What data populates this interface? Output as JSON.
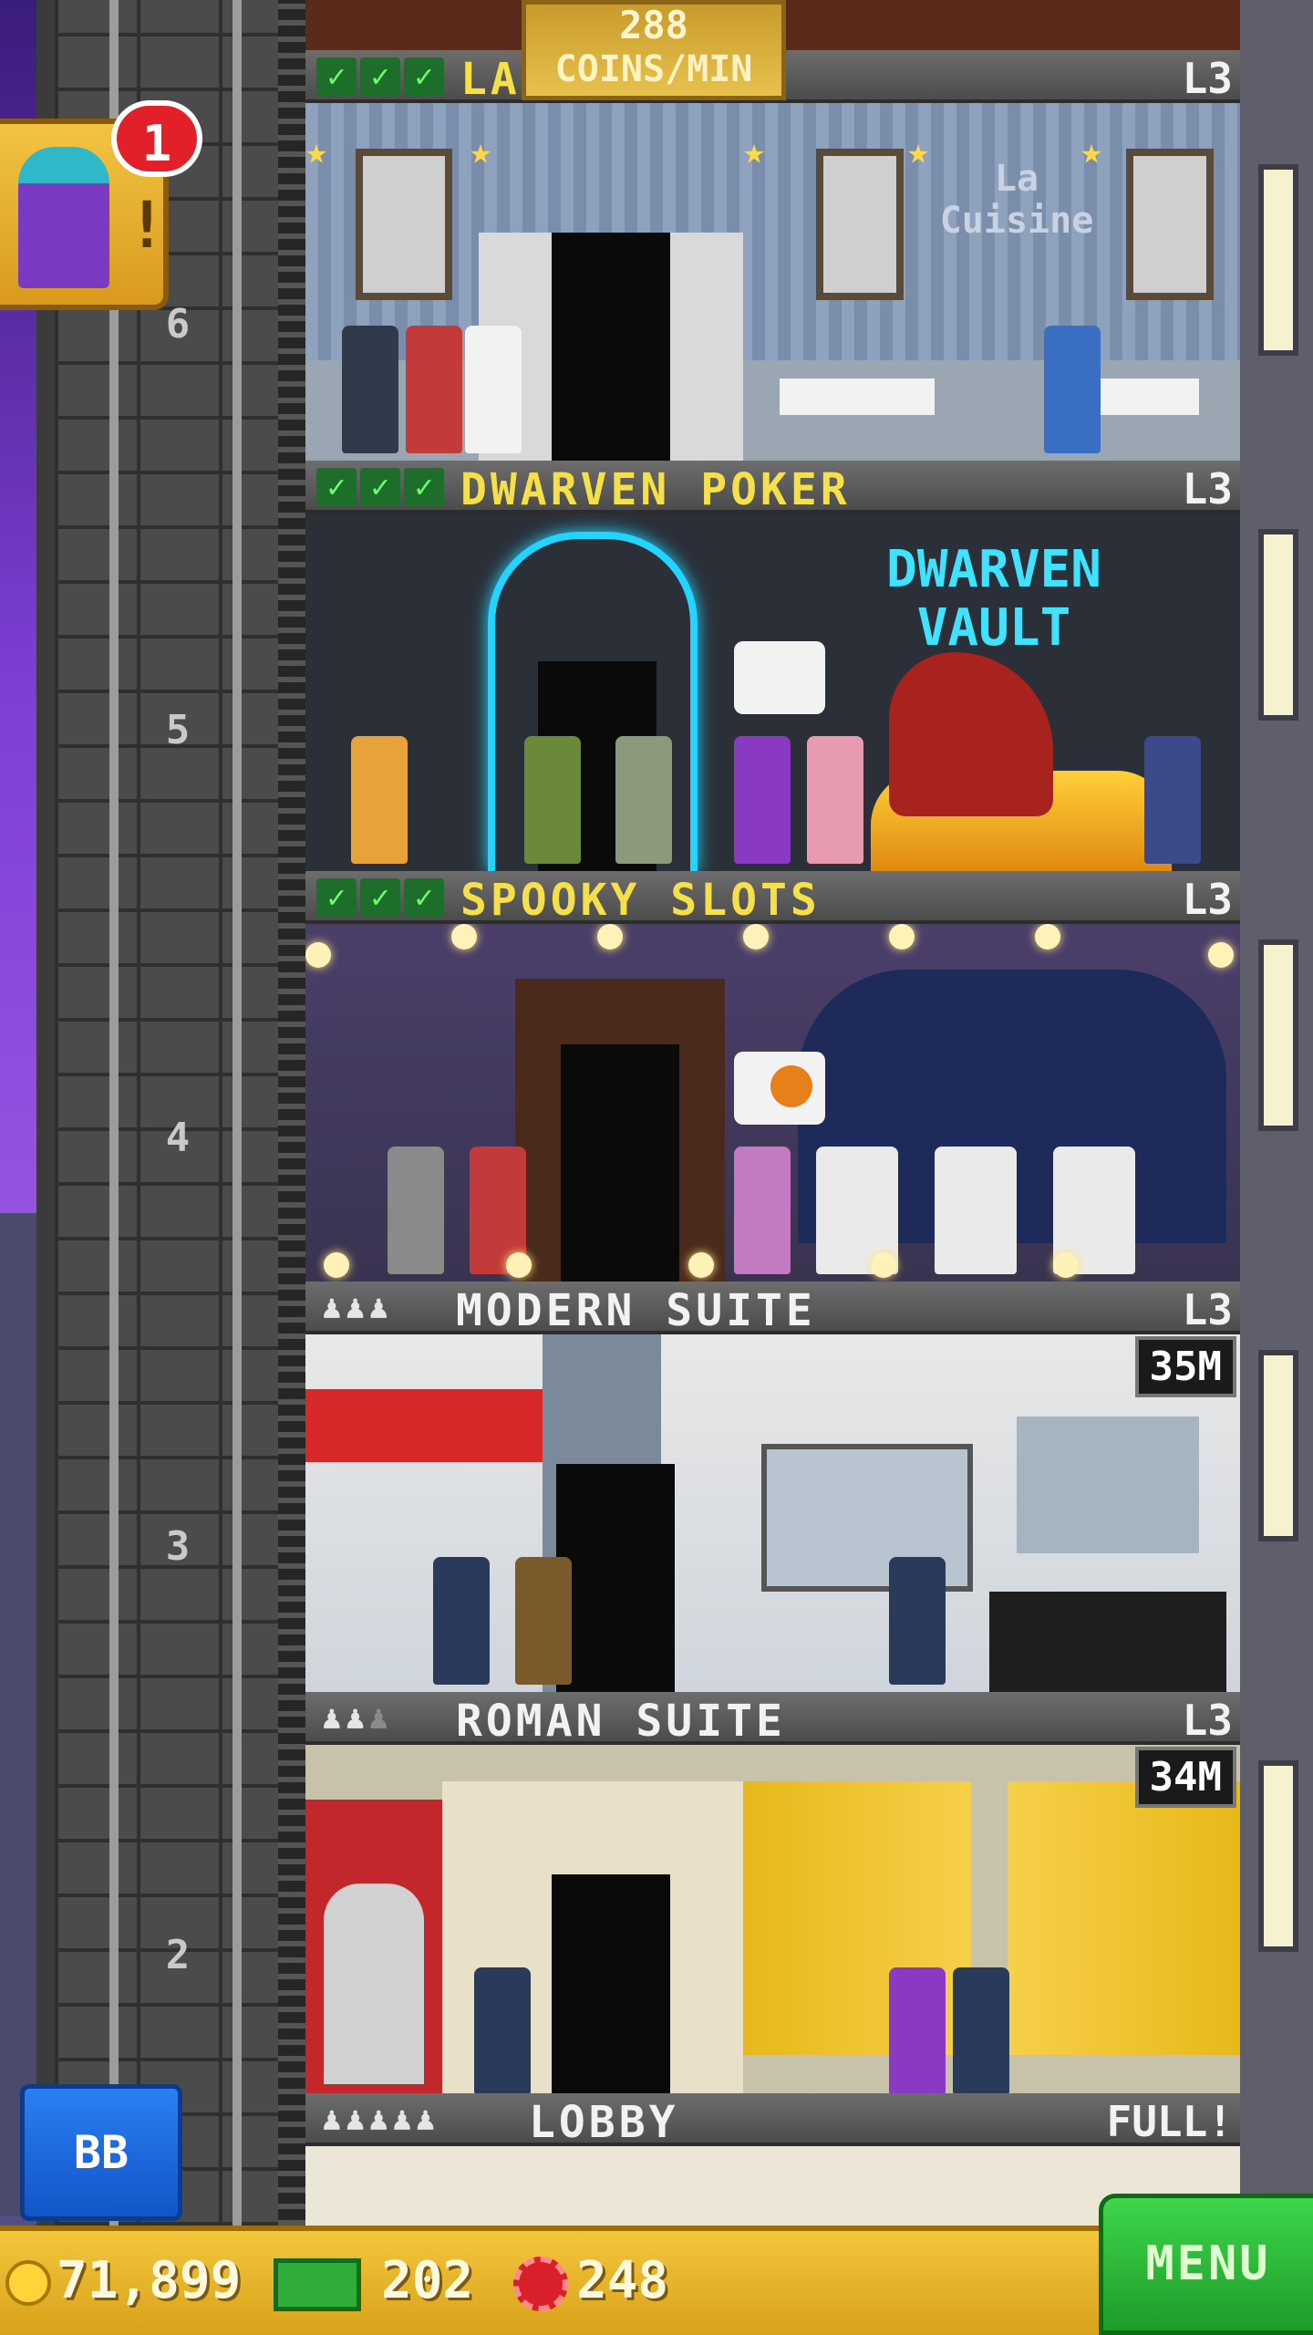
{
  "coin_rate": {
    "value": "288",
    "label": "COINS/MIN"
  },
  "notification": {
    "count": "1",
    "excl": "!"
  },
  "floors": [
    {
      "id": "6",
      "name": "LA",
      "level": "L3",
      "sign": "La Cuisine"
    },
    {
      "id": "5",
      "name": "DWARVEN POKER",
      "level": "L3",
      "sign": "DWARVEN VAULT"
    },
    {
      "id": "4",
      "name": "SPOOKY SLOTS",
      "level": "L3"
    },
    {
      "id": "3",
      "name": "MODERN SUITE",
      "level": "L3",
      "price": "35M"
    },
    {
      "id": "2",
      "name": "ROMAN SUITE",
      "level": "L3",
      "price": "34M"
    },
    {
      "id": "L",
      "name": "LOBBY",
      "level": "FULL!"
    }
  ],
  "checks": "✓",
  "pawn": "♟",
  "bb_button": "BB",
  "bottom": {
    "coins": "71,899",
    "bux": "202",
    "chips": "248"
  },
  "menu_label": "MENU",
  "colors": {
    "gold": "#e7c14e",
    "green": "#2fae3a",
    "blue": "#1d6bdc",
    "yellow_text": "#f6e04a"
  }
}
